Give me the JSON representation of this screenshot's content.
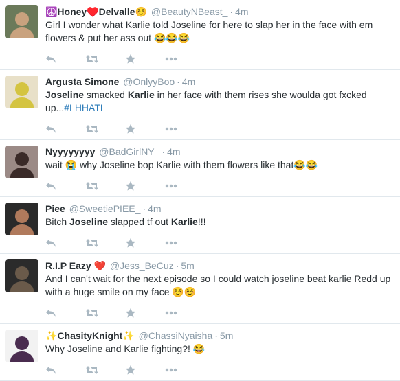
{
  "tweets": [
    {
      "name": "☮️Honey♥️Delvalle☺️",
      "handle": "@BeautyNBeast_",
      "time": "4m",
      "text": [
        {
          "t": "Girl I wonder what Karlie told Joseline for here to slap her in the face with em flowers & put her ass out 😂😂😂"
        }
      ],
      "avatar_colors": [
        "#6b7a5a",
        "#c9a27e"
      ]
    },
    {
      "name": "Argusta Simone",
      "handle": "@OnlyyBoo",
      "time": "4m",
      "text": [
        {
          "t": "Joseline",
          "b": true
        },
        {
          "t": " smacked "
        },
        {
          "t": "Karlie",
          "b": true
        },
        {
          "t": " in her face with them rises she woulda got fxcked up..."
        },
        {
          "t": "#LHHATL",
          "tag": true
        }
      ],
      "avatar_colors": [
        "#e8e0c8",
        "#d4c441"
      ]
    },
    {
      "name": "Nyyyyyyyy",
      "handle": "@BadGirlNY_",
      "time": "4m",
      "text": [
        {
          "t": "wait 😭 why Joseline bop Karlie with them flowers like that😂😂"
        }
      ],
      "avatar_colors": [
        "#9b8a86",
        "#3a2a28"
      ]
    },
    {
      "name": "Piee",
      "handle": "@SweetiePIEE_",
      "time": "4m",
      "text": [
        {
          "t": "Bitch "
        },
        {
          "t": "Joseline",
          "b": true
        },
        {
          "t": " slapped tf out "
        },
        {
          "t": "Karlie",
          "b": true
        },
        {
          "t": "!!!"
        }
      ],
      "avatar_colors": [
        "#2a2a2a",
        "#b07a5c"
      ]
    },
    {
      "name": "R.I.P Eazy ❤️",
      "handle": "@Jess_BeCuz",
      "time": "5m",
      "text": [
        {
          "t": "And I can't wait for the next episode so I could watch joseline beat karlie Redd up with a huge smile on my face ☺️☺️"
        }
      ],
      "avatar_colors": [
        "#2b2b2b",
        "#6a5a4a"
      ]
    },
    {
      "name": "✨ChasityKnight✨",
      "handle": "@ChassiNyaisha",
      "time": "5m",
      "text": [
        {
          "t": "Why Joseline and Karlie fighting?! 😂"
        }
      ],
      "avatar_colors": [
        "#f2f2f2",
        "#4a2c4f"
      ]
    }
  ],
  "action_icons": [
    "reply-icon",
    "retweet-icon",
    "favorite-icon",
    "more-icon"
  ],
  "colors": {
    "text": "#292f33",
    "muted": "#8899a6",
    "link": "#2b7bb9",
    "divider": "#e1e8ed",
    "icon": "#aab8c2"
  }
}
